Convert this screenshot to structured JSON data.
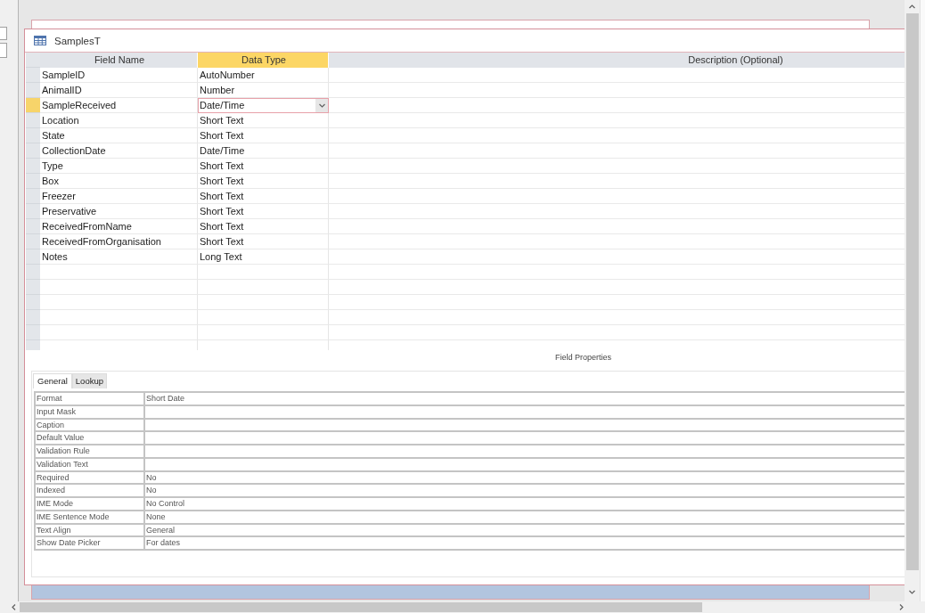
{
  "window": {
    "title": "SamplesT"
  },
  "design_grid": {
    "columns": [
      {
        "label": "Field Name",
        "selected": false
      },
      {
        "label": "Data Type",
        "selected": true
      },
      {
        "label": "Description (Optional)",
        "selected": false
      }
    ],
    "rows": [
      {
        "field_name": "SampleID",
        "data_type": "AutoNumber",
        "selected": false
      },
      {
        "field_name": "AnimalID",
        "data_type": "Number",
        "selected": false
      },
      {
        "field_name": "SampleReceived",
        "data_type": "Date/Time",
        "selected": true
      },
      {
        "field_name": "Location",
        "data_type": "Short Text",
        "selected": false
      },
      {
        "field_name": "State",
        "data_type": "Short Text",
        "selected": false
      },
      {
        "field_name": "CollectionDate",
        "data_type": "Date/Time",
        "selected": false
      },
      {
        "field_name": "Type",
        "data_type": "Short Text",
        "selected": false
      },
      {
        "field_name": "Box",
        "data_type": "Short Text",
        "selected": false
      },
      {
        "field_name": "Freezer",
        "data_type": "Short Text",
        "selected": false
      },
      {
        "field_name": "Preservative",
        "data_type": "Short Text",
        "selected": false
      },
      {
        "field_name": "ReceivedFromName",
        "data_type": "Short Text",
        "selected": false
      },
      {
        "field_name": "ReceivedFromOrganisation",
        "data_type": "Short Text",
        "selected": false
      },
      {
        "field_name": "Notes",
        "data_type": "Long Text",
        "selected": false
      }
    ]
  },
  "field_properties": {
    "title": "Field Properties",
    "tabs": [
      {
        "label": "General",
        "selected": true
      },
      {
        "label": "Lookup",
        "selected": false
      }
    ],
    "properties": [
      {
        "label": "Format",
        "value": "Short Date"
      },
      {
        "label": "Input Mask"
      },
      {
        "label": "Caption"
      },
      {
        "label": "Default Value"
      },
      {
        "label": "Validation Rule"
      },
      {
        "label": "Validation Text"
      },
      {
        "label": "Required",
        "value": "No"
      },
      {
        "label": "Indexed",
        "value": "No"
      },
      {
        "label": "IME Mode",
        "value": "No Control"
      },
      {
        "label": "IME Sentence Mode",
        "value": "None"
      },
      {
        "label": "Text Align",
        "value": "General"
      },
      {
        "label": "Show Date Picker",
        "value": "For dates"
      }
    ]
  }
}
